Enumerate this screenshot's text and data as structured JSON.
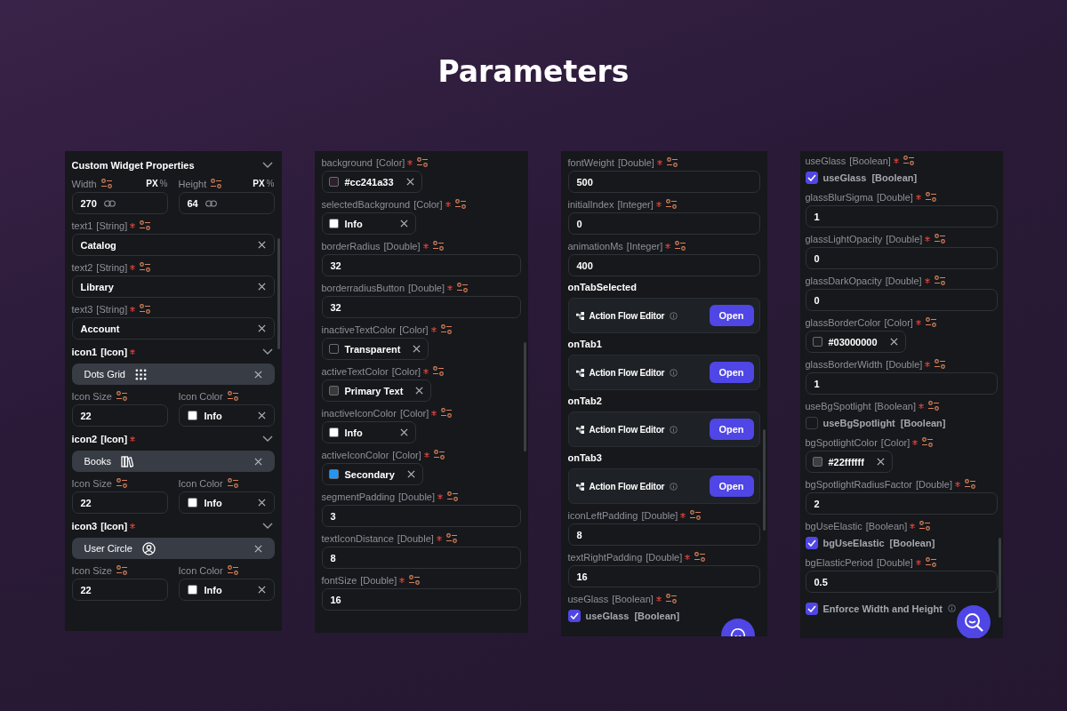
{
  "page_title": "Parameters",
  "panels": [
    {
      "floating_button": false,
      "rows": [
        {
          "kind": "header",
          "title": "Custom Widget Properties"
        },
        {
          "kind": "dims",
          "items": [
            {
              "label": "Width",
              "unit": "PX",
              "alt_unit": "%",
              "value": "270"
            },
            {
              "label": "Height",
              "unit": "PX",
              "alt_unit": "%",
              "value": "64"
            }
          ]
        },
        {
          "kind": "text",
          "name": "text1",
          "type": "[String]",
          "required": true,
          "value": "Catalog"
        },
        {
          "kind": "text",
          "name": "text2",
          "type": "[String]",
          "required": true,
          "value": "Library"
        },
        {
          "kind": "text",
          "name": "text3",
          "type": "[String]",
          "required": true,
          "value": "Account"
        },
        {
          "kind": "icon",
          "name": "icon1",
          "type": "[Icon]",
          "required": true,
          "icon_name": "Dots Grid",
          "size_label": "Icon Size",
          "size": "22",
          "color_label": "Icon Color",
          "color_value": "Info",
          "color": "#ffffff"
        },
        {
          "kind": "icon",
          "name": "icon2",
          "type": "[Icon]",
          "required": true,
          "icon_name": "Books",
          "size_label": "Icon Size",
          "size": "22",
          "color_label": "Icon Color",
          "color_value": "Info",
          "color": "#ffffff"
        },
        {
          "kind": "icon",
          "name": "icon3",
          "type": "[Icon]",
          "required": true,
          "icon_name": "User Circle",
          "size_label": "Icon Size",
          "size": "22",
          "color_label": "Icon Color",
          "color_value": "Info",
          "color": "#ffffff"
        }
      ]
    },
    {
      "floating_button": false,
      "rows": [
        {
          "kind": "color",
          "name": "background",
          "type": "[Color]",
          "required": true,
          "value": "#cc241a33",
          "color": "#2d1f2c"
        },
        {
          "kind": "color",
          "name": "selectedBackground",
          "type": "[Color]",
          "required": true,
          "value": "Info",
          "color": "#ffffff"
        },
        {
          "kind": "number",
          "name": "borderRadius",
          "type": "[Double]",
          "required": true,
          "value": "32"
        },
        {
          "kind": "number",
          "name": "borderradiusButton",
          "type": "[Double]",
          "required": true,
          "value": "32"
        },
        {
          "kind": "color",
          "name": "inactiveTextColor",
          "type": "[Color]",
          "required": true,
          "value": "Transparent",
          "color": "#17191c"
        },
        {
          "kind": "color",
          "name": "activeTextColor",
          "type": "[Color]",
          "required": true,
          "value": "Primary Text",
          "color": "#3a3a3a"
        },
        {
          "kind": "color",
          "name": "inactiveIconColor",
          "type": "[Color]",
          "required": true,
          "value": "Info",
          "color": "#ffffff"
        },
        {
          "kind": "color",
          "name": "activeIconColor",
          "type": "[Color]",
          "required": true,
          "value": "Secondary",
          "color": "#2196f3"
        },
        {
          "kind": "number",
          "name": "segmentPadding",
          "type": "[Double]",
          "required": true,
          "value": "3"
        },
        {
          "kind": "number",
          "name": "textIconDistance",
          "type": "[Double]",
          "required": true,
          "value": "8"
        },
        {
          "kind": "number",
          "name": "fontSize",
          "type": "[Double]",
          "required": true,
          "value": "16"
        }
      ]
    },
    {
      "floating_button": true,
      "rows": [
        {
          "kind": "number",
          "name": "fontWeight",
          "type": "[Double]",
          "required": true,
          "value": "500"
        },
        {
          "kind": "number",
          "name": "initialIndex",
          "type": "[Integer]",
          "required": true,
          "value": "0"
        },
        {
          "kind": "number",
          "name": "animationMs",
          "type": "[Integer]",
          "required": true,
          "value": "400"
        },
        {
          "kind": "event",
          "title": "onTabSelected",
          "editor": "Action Flow Editor",
          "button": "Open"
        },
        {
          "kind": "event",
          "title": "onTab1",
          "editor": "Action Flow Editor",
          "button": "Open"
        },
        {
          "kind": "event",
          "title": "onTab2",
          "editor": "Action Flow Editor",
          "button": "Open"
        },
        {
          "kind": "event",
          "title": "onTab3",
          "editor": "Action Flow Editor",
          "button": "Open"
        },
        {
          "kind": "number",
          "name": "iconLeftPadding",
          "type": "[Double]",
          "required": true,
          "value": "8"
        },
        {
          "kind": "number",
          "name": "textRightPadding",
          "type": "[Double]",
          "required": true,
          "value": "16"
        },
        {
          "kind": "boolean",
          "name": "useGlass",
          "type": "[Boolean]",
          "required": true,
          "checked": true,
          "check_name": "useGlass",
          "check_type": "[Boolean]"
        }
      ]
    },
    {
      "floating_button": true,
      "rows": [
        {
          "kind": "boolean",
          "name": "useGlass",
          "type": "[Boolean]",
          "required": true,
          "checked": true,
          "check_name": "useGlass",
          "check_type": "[Boolean]"
        },
        {
          "kind": "number",
          "name": "glassBlurSigma",
          "type": "[Double]",
          "required": true,
          "value": "1"
        },
        {
          "kind": "number",
          "name": "glassLightOpacity",
          "type": "[Double]",
          "required": true,
          "value": "0"
        },
        {
          "kind": "number",
          "name": "glassDarkOpacity",
          "type": "[Double]",
          "required": true,
          "value": "0"
        },
        {
          "kind": "color",
          "name": "glassBorderColor",
          "type": "[Color]",
          "required": true,
          "value": "#03000000",
          "color": "#1c1e22"
        },
        {
          "kind": "number",
          "name": "glassBorderWidth",
          "type": "[Double]",
          "required": true,
          "value": "1"
        },
        {
          "kind": "boolean",
          "name": "useBgSpotlight",
          "type": "[Boolean]",
          "required": true,
          "checked": false,
          "check_name": "useBgSpotlight",
          "check_type": "[Boolean]"
        },
        {
          "kind": "color",
          "name": "bgSpotlightColor",
          "type": "[Color]",
          "required": true,
          "value": "#22ffffff",
          "color": "#3c3e42"
        },
        {
          "kind": "number",
          "name": "bgSpotlightRadiusFactor",
          "type": "[Double]",
          "required": true,
          "value": "2"
        },
        {
          "kind": "boolean",
          "name": "bgUseElastic",
          "type": "[Boolean]",
          "required": true,
          "checked": true,
          "check_name": "bgUseElastic",
          "check_type": "[Boolean]"
        },
        {
          "kind": "number",
          "name": "bgElasticPeriod",
          "type": "[Double]",
          "required": true,
          "value": "0.5"
        },
        {
          "kind": "check",
          "checked": true,
          "label": "Enforce Width and Height"
        }
      ]
    }
  ]
}
